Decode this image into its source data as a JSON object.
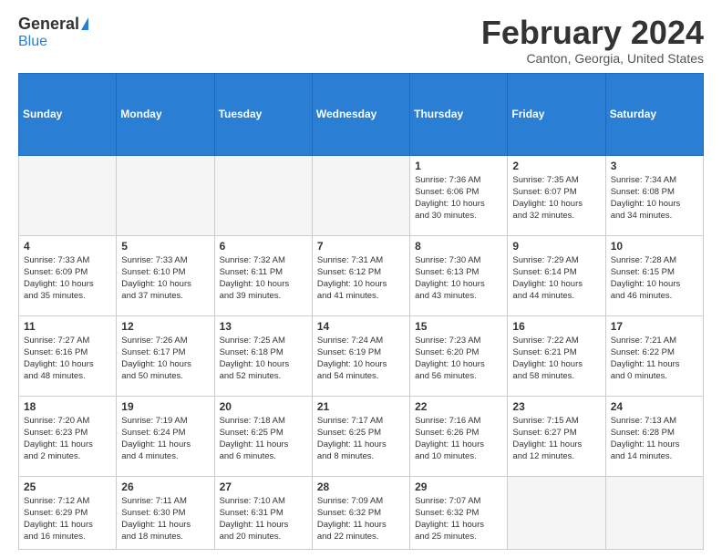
{
  "logo": {
    "general": "General",
    "blue": "Blue"
  },
  "title": "February 2024",
  "location": "Canton, Georgia, United States",
  "days_of_week": [
    "Sunday",
    "Monday",
    "Tuesday",
    "Wednesday",
    "Thursday",
    "Friday",
    "Saturday"
  ],
  "weeks": [
    [
      {
        "day": "",
        "info": ""
      },
      {
        "day": "",
        "info": ""
      },
      {
        "day": "",
        "info": ""
      },
      {
        "day": "",
        "info": ""
      },
      {
        "day": "1",
        "info": "Sunrise: 7:36 AM\nSunset: 6:06 PM\nDaylight: 10 hours\nand 30 minutes."
      },
      {
        "day": "2",
        "info": "Sunrise: 7:35 AM\nSunset: 6:07 PM\nDaylight: 10 hours\nand 32 minutes."
      },
      {
        "day": "3",
        "info": "Sunrise: 7:34 AM\nSunset: 6:08 PM\nDaylight: 10 hours\nand 34 minutes."
      }
    ],
    [
      {
        "day": "4",
        "info": "Sunrise: 7:33 AM\nSunset: 6:09 PM\nDaylight: 10 hours\nand 35 minutes."
      },
      {
        "day": "5",
        "info": "Sunrise: 7:33 AM\nSunset: 6:10 PM\nDaylight: 10 hours\nand 37 minutes."
      },
      {
        "day": "6",
        "info": "Sunrise: 7:32 AM\nSunset: 6:11 PM\nDaylight: 10 hours\nand 39 minutes."
      },
      {
        "day": "7",
        "info": "Sunrise: 7:31 AM\nSunset: 6:12 PM\nDaylight: 10 hours\nand 41 minutes."
      },
      {
        "day": "8",
        "info": "Sunrise: 7:30 AM\nSunset: 6:13 PM\nDaylight: 10 hours\nand 43 minutes."
      },
      {
        "day": "9",
        "info": "Sunrise: 7:29 AM\nSunset: 6:14 PM\nDaylight: 10 hours\nand 44 minutes."
      },
      {
        "day": "10",
        "info": "Sunrise: 7:28 AM\nSunset: 6:15 PM\nDaylight: 10 hours\nand 46 minutes."
      }
    ],
    [
      {
        "day": "11",
        "info": "Sunrise: 7:27 AM\nSunset: 6:16 PM\nDaylight: 10 hours\nand 48 minutes."
      },
      {
        "day": "12",
        "info": "Sunrise: 7:26 AM\nSunset: 6:17 PM\nDaylight: 10 hours\nand 50 minutes."
      },
      {
        "day": "13",
        "info": "Sunrise: 7:25 AM\nSunset: 6:18 PM\nDaylight: 10 hours\nand 52 minutes."
      },
      {
        "day": "14",
        "info": "Sunrise: 7:24 AM\nSunset: 6:19 PM\nDaylight: 10 hours\nand 54 minutes."
      },
      {
        "day": "15",
        "info": "Sunrise: 7:23 AM\nSunset: 6:20 PM\nDaylight: 10 hours\nand 56 minutes."
      },
      {
        "day": "16",
        "info": "Sunrise: 7:22 AM\nSunset: 6:21 PM\nDaylight: 10 hours\nand 58 minutes."
      },
      {
        "day": "17",
        "info": "Sunrise: 7:21 AM\nSunset: 6:22 PM\nDaylight: 11 hours\nand 0 minutes."
      }
    ],
    [
      {
        "day": "18",
        "info": "Sunrise: 7:20 AM\nSunset: 6:23 PM\nDaylight: 11 hours\nand 2 minutes."
      },
      {
        "day": "19",
        "info": "Sunrise: 7:19 AM\nSunset: 6:24 PM\nDaylight: 11 hours\nand 4 minutes."
      },
      {
        "day": "20",
        "info": "Sunrise: 7:18 AM\nSunset: 6:25 PM\nDaylight: 11 hours\nand 6 minutes."
      },
      {
        "day": "21",
        "info": "Sunrise: 7:17 AM\nSunset: 6:25 PM\nDaylight: 11 hours\nand 8 minutes."
      },
      {
        "day": "22",
        "info": "Sunrise: 7:16 AM\nSunset: 6:26 PM\nDaylight: 11 hours\nand 10 minutes."
      },
      {
        "day": "23",
        "info": "Sunrise: 7:15 AM\nSunset: 6:27 PM\nDaylight: 11 hours\nand 12 minutes."
      },
      {
        "day": "24",
        "info": "Sunrise: 7:13 AM\nSunset: 6:28 PM\nDaylight: 11 hours\nand 14 minutes."
      }
    ],
    [
      {
        "day": "25",
        "info": "Sunrise: 7:12 AM\nSunset: 6:29 PM\nDaylight: 11 hours\nand 16 minutes."
      },
      {
        "day": "26",
        "info": "Sunrise: 7:11 AM\nSunset: 6:30 PM\nDaylight: 11 hours\nand 18 minutes."
      },
      {
        "day": "27",
        "info": "Sunrise: 7:10 AM\nSunset: 6:31 PM\nDaylight: 11 hours\nand 20 minutes."
      },
      {
        "day": "28",
        "info": "Sunrise: 7:09 AM\nSunset: 6:32 PM\nDaylight: 11 hours\nand 22 minutes."
      },
      {
        "day": "29",
        "info": "Sunrise: 7:07 AM\nSunset: 6:32 PM\nDaylight: 11 hours\nand 25 minutes."
      },
      {
        "day": "",
        "info": ""
      },
      {
        "day": "",
        "info": ""
      }
    ]
  ]
}
